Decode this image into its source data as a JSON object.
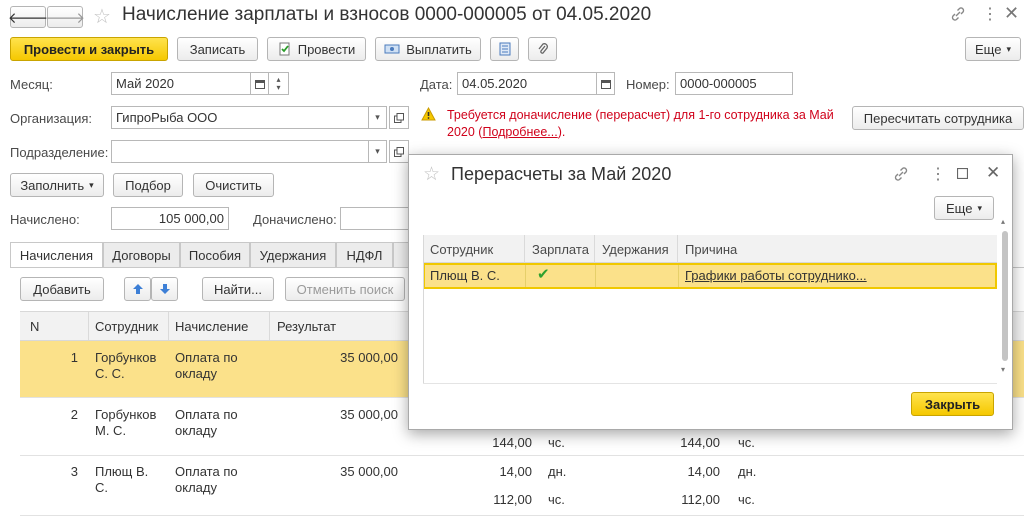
{
  "window": {
    "title": "Начисление зарплаты и взносов 0000-000005 от 04.05.2020",
    "colors": {
      "accent": "#f5c800",
      "warning_text": "#d0021b",
      "row_highlight": "#fbe18a"
    }
  },
  "toolbar": {
    "post_and_close": "Провести и закрыть",
    "save": "Записать",
    "post": "Провести",
    "pay": "Выплатить",
    "more": "Еще"
  },
  "form": {
    "month_label": "Месяц:",
    "month_value": "Май 2020",
    "date_label": "Дата:",
    "date_value": "04.05.2020",
    "number_label": "Номер:",
    "number_value": "0000-000005",
    "org_label": "Организация:",
    "org_value": "ГипроРыба ООО",
    "dept_label": "Подразделение:",
    "dept_value": "",
    "warning_text_1": "Требуется доначисление (перерасчет) для 1-го сотрудника за Май",
    "warning_text_2a": "2020 (",
    "warning_link": "Подробнее...",
    "warning_text_2b": ").",
    "recalc_button": "Пересчитать сотрудника",
    "fill_button": "Заполнить",
    "select_button": "Подбор",
    "clear_button": "Очистить",
    "accrued_label": "Начислено:",
    "accrued_value": "105 000,00",
    "extra_label": "Доначислено:"
  },
  "tabs": [
    "Начисления",
    "Договоры",
    "Пособия",
    "Удержания",
    "НДФЛ"
  ],
  "table_toolbar": {
    "add": "Добавить",
    "find": "Найти...",
    "cancel_search": "Отменить поиск"
  },
  "table": {
    "headers": [
      "N",
      "Сотрудник",
      "Начисление",
      "Результат"
    ],
    "rows": [
      {
        "n": "1",
        "employee_1": "Горбунков",
        "employee_2": "С. С.",
        "accrual_1": "Оплата по",
        "accrual_2": "окладу",
        "result": "35 000,00"
      },
      {
        "n": "2",
        "employee_1": "Горбунков",
        "employee_2": "М. С.",
        "accrual_1": "Оплата по",
        "accrual_2": "окладу",
        "result": "35 000,00"
      },
      {
        "n": "3",
        "employee_1": "Плющ В.",
        "employee_2": "С.",
        "accrual_1": "Оплата по",
        "accrual_2": "окладу",
        "result": "35 000,00"
      }
    ],
    "extra": {
      "r2_a": "144,00",
      "r2_b": "чс.",
      "r2_c": "144,00",
      "r2_d": "чс.",
      "r3a_a": "14,00",
      "r3a_b": "дн.",
      "r3a_c": "14,00",
      "r3a_d": "дн.",
      "r3b_a": "112,00",
      "r3b_b": "чс.",
      "r3b_c": "112,00",
      "r3b_d": "чс."
    }
  },
  "popup": {
    "title": "Перерасчеты за Май 2020",
    "more": "Еще",
    "headers": [
      "Сотрудник",
      "Зарплата",
      "Удержания",
      "Причина"
    ],
    "row": {
      "employee": "Плющ В. С.",
      "salary_check": "✔",
      "deductions": "",
      "reason": "Графики работы сотруднико..."
    },
    "close_button": "Закрыть"
  }
}
